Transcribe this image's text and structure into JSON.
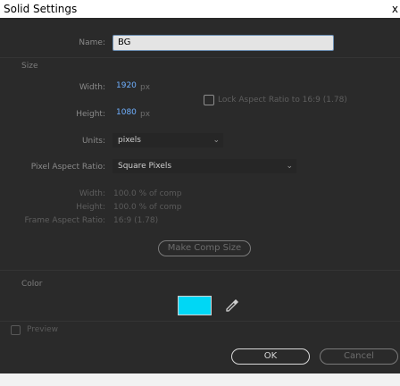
{
  "window": {
    "title": "Solid Settings",
    "close_glyph": "x"
  },
  "name": {
    "label": "Name:",
    "value": "BG"
  },
  "size": {
    "section": "Size",
    "width_label": "Width:",
    "width_value": "1920",
    "width_unit": "px",
    "height_label": "Height:",
    "height_value": "1080",
    "height_unit": "px",
    "lock_label": "Lock Aspect Ratio to 16:9 (1.78)",
    "units_label": "Units:",
    "units_value": "pixels",
    "par_label": "Pixel Aspect Ratio:",
    "par_value": "Square Pixels",
    "info_width_label": "Width:",
    "info_width_value": "100.0 % of comp",
    "info_height_label": "Height:",
    "info_height_value": "100.0 % of comp",
    "frame_aspect_label": "Frame Aspect Ratio:",
    "frame_aspect_value": "16:9 (1.78)",
    "make_comp_size": "Make Comp Size"
  },
  "color": {
    "section": "Color",
    "swatch_hex": "#00d7f5",
    "eyedropper_icon": "eyedropper-icon"
  },
  "footer": {
    "preview_label": "Preview",
    "ok_label": "OK",
    "cancel_label": "Cancel"
  }
}
